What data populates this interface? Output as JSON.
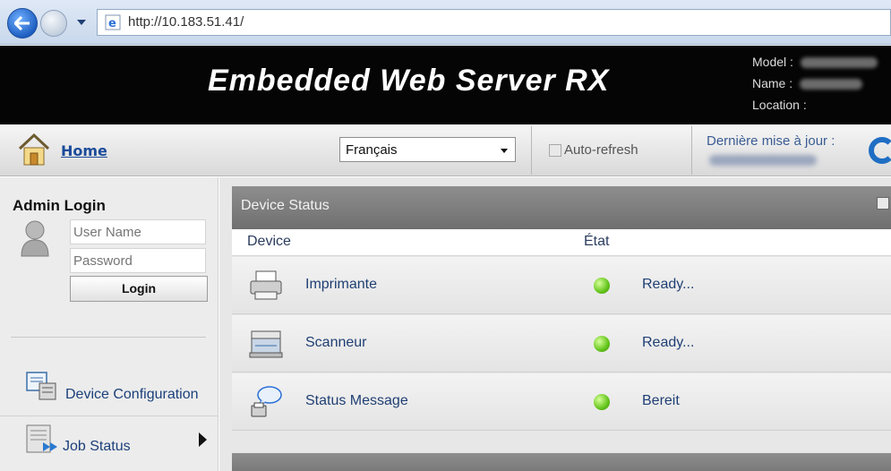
{
  "browser": {
    "url": "http://10.183.51.41/"
  },
  "header": {
    "title": "Embedded Web Server RX",
    "model_label": "Model :",
    "name_label": "Name :",
    "location_label": "Location :"
  },
  "toolbar": {
    "home_label": "Home",
    "language_selected": "Français",
    "auto_refresh_label": "Auto-refresh",
    "last_update_label": "Dernière mise à jour :"
  },
  "sidebar": {
    "admin_title": "Admin Login",
    "username_placeholder": "User Name",
    "password_placeholder": "Password",
    "login_label": "Login",
    "nav_items": [
      {
        "label": "Device Configuration"
      },
      {
        "label": "Job Status"
      }
    ]
  },
  "device_status": {
    "title": "Device Status",
    "col_device": "Device",
    "col_state": "État",
    "rows": [
      {
        "name": "Imprimante",
        "state": "Ready...",
        "led_color": "#63c41a",
        "icon": "printer-icon"
      },
      {
        "name": "Scanneur",
        "state": "Ready...",
        "led_color": "#63c41a",
        "icon": "scanner-icon"
      },
      {
        "name": "Status Message",
        "state": "Bereit",
        "led_color": "#63c41a",
        "icon": "status-message-icon"
      }
    ]
  },
  "colors": {
    "header_bg": "#050505",
    "link_blue": "#1b4b9a",
    "status_green": "#63c41a"
  }
}
